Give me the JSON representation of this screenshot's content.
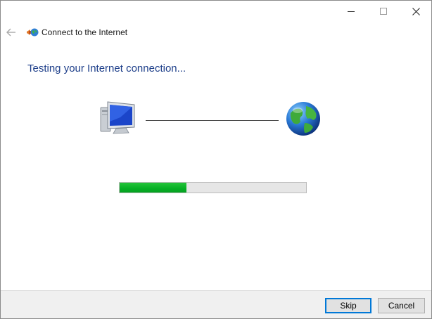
{
  "window": {
    "controls": {
      "minimize_icon": "minimize-icon",
      "maximize_icon": "maximize-icon",
      "close_icon": "close-icon"
    }
  },
  "header": {
    "back_icon": "back-arrow-icon",
    "app_icon": "connect-internet-icon",
    "title": "Connect to the Internet"
  },
  "main": {
    "heading": "Testing your Internet connection...",
    "computer_icon": "computer-icon",
    "globe_icon": "globe-icon",
    "progress_fraction": 0.36,
    "progress_color": "#06b025"
  },
  "footer": {
    "skip_label": "Skip",
    "cancel_label": "Cancel"
  },
  "colors": {
    "heading": "#1e3f8a",
    "accent_focus": "#0078d7"
  }
}
